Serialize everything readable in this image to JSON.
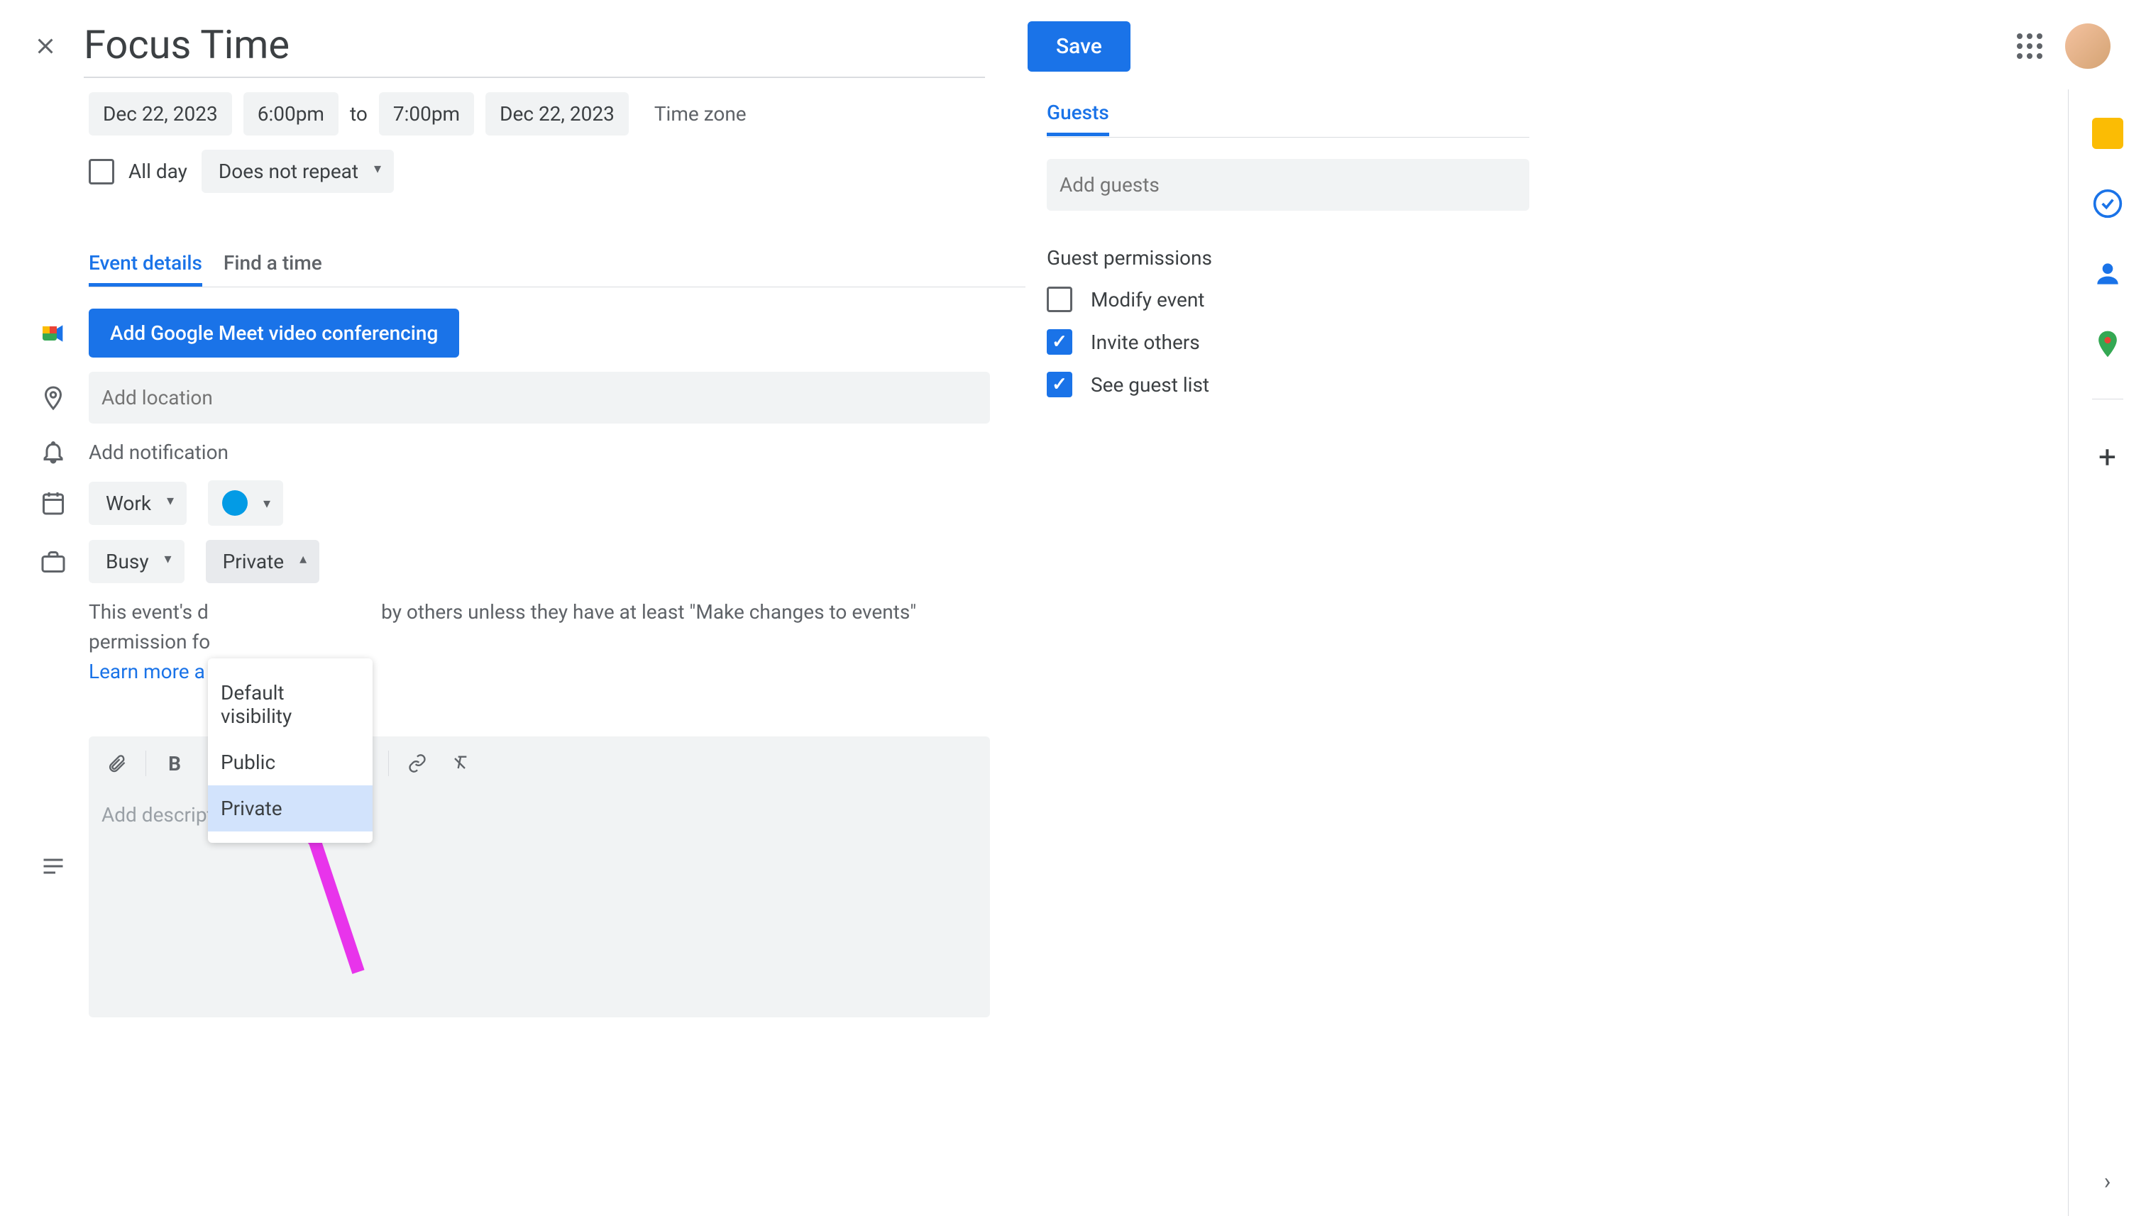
{
  "header": {
    "title": "Focus Time",
    "save_label": "Save"
  },
  "datetime": {
    "start_date": "Dec 22, 2023",
    "start_time": "6:00pm",
    "to_label": "to",
    "end_time": "7:00pm",
    "end_date": "Dec 22, 2023",
    "timezone_label": "Time zone"
  },
  "allday": {
    "label": "All day",
    "repeat": "Does not repeat"
  },
  "tabs": {
    "details": "Event details",
    "findtime": "Find a time"
  },
  "meet": {
    "button_label": "Add Google Meet video conferencing"
  },
  "location": {
    "placeholder": "Add location"
  },
  "notification": {
    "label": "Add notification"
  },
  "calendar": {
    "name": "Work"
  },
  "availability": {
    "busy": "Busy",
    "visibility": "Private"
  },
  "visibility_options": {
    "default": "Default visibility",
    "public": "Public",
    "private": "Private"
  },
  "info": {
    "text_part1": "This event's d",
    "text_part2": " by others unless they have at least \"Make changes to events\" permission fo",
    "learn_more": "Learn more a"
  },
  "description": {
    "placeholder": "Add description"
  },
  "guests": {
    "tab_label": "Guests",
    "input_placeholder": "Add guests",
    "permissions_title": "Guest permissions",
    "modify": "Modify event",
    "invite": "Invite others",
    "seelist": "See guest list"
  }
}
